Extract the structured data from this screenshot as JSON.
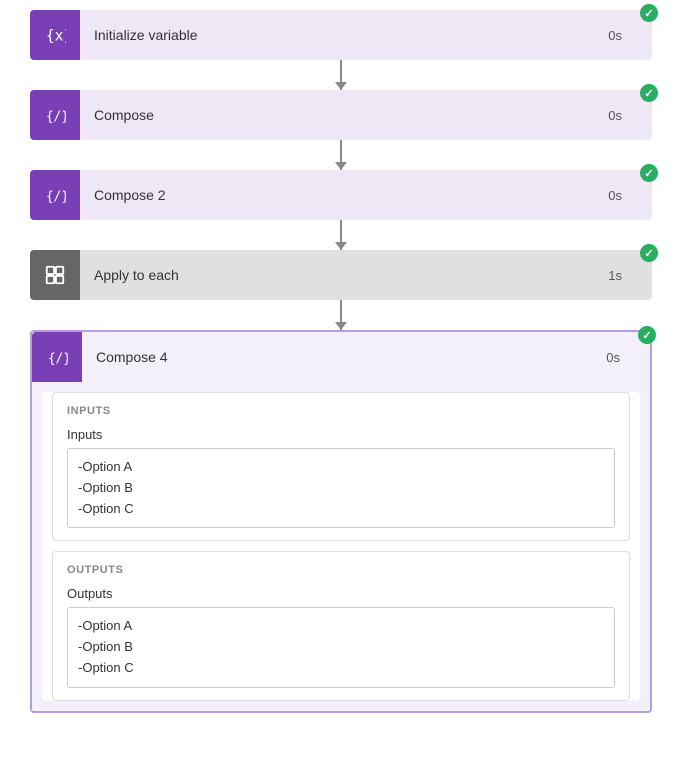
{
  "steps": [
    {
      "id": "init-var",
      "label": "Initialize variable",
      "duration": "0s",
      "type": "init-var",
      "success": true,
      "iconType": "braces"
    },
    {
      "id": "compose",
      "label": "Compose",
      "duration": "0s",
      "type": "compose",
      "success": true,
      "iconType": "braces"
    },
    {
      "id": "compose2",
      "label": "Compose 2",
      "duration": "0s",
      "type": "compose2",
      "success": true,
      "iconType": "braces"
    },
    {
      "id": "apply-each",
      "label": "Apply to each",
      "duration": "1s",
      "type": "apply",
      "success": true,
      "iconType": "loop"
    }
  ],
  "expanded_step": {
    "id": "compose4",
    "label": "Compose 4",
    "duration": "0s",
    "success": true,
    "inputs_section_label": "INPUTS",
    "inputs_field_label": "Inputs",
    "inputs_lines": [
      "-Option A",
      "-Option B",
      "-Option C"
    ],
    "outputs_section_label": "OUTPUTS",
    "outputs_field_label": "Outputs",
    "outputs_lines": [
      "-Option A",
      "-Option B",
      "-Option C"
    ]
  }
}
